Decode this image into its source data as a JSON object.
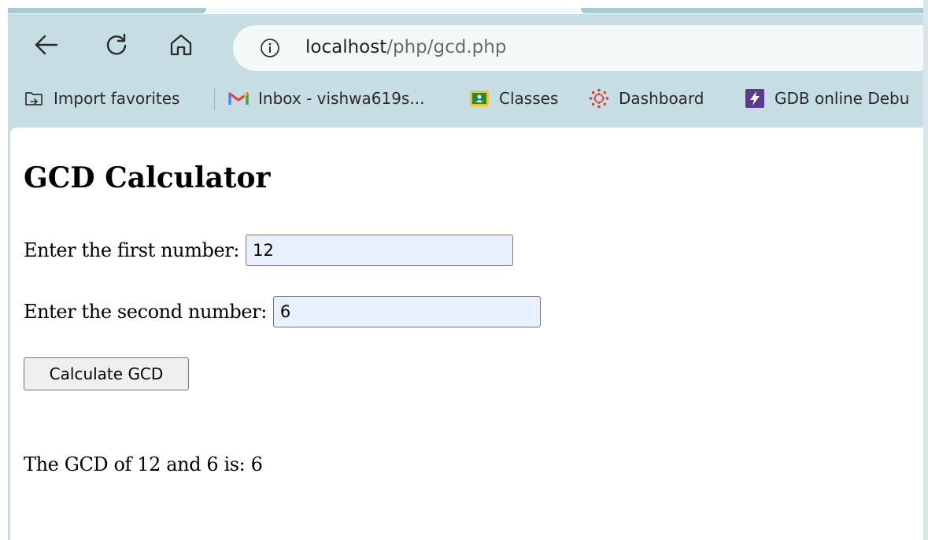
{
  "browser": {
    "url_host": "localhost",
    "url_path": "/php/gcd.php",
    "bookmarks": [
      {
        "label": "Import favorites",
        "icon": "import-favorites-icon"
      },
      {
        "label": "Inbox  - vishwa619s...",
        "icon": "gmail-icon"
      },
      {
        "label": "Classes",
        "icon": "google-classroom-icon"
      },
      {
        "label": "Dashboard",
        "icon": "canvas-lms-icon"
      },
      {
        "label": "GDB online Debu",
        "icon": "gdb-lightning-icon"
      }
    ]
  },
  "page": {
    "title": "GCD Calculator",
    "first_label": "Enter the first number:",
    "first_value": "12",
    "second_label": "Enter the second number:",
    "second_value": "6",
    "button_label": "Calculate GCD",
    "result": "The GCD of 12 and 6 is: 6"
  },
  "colors": {
    "frame": "#c6dde3",
    "input_autofill": "#e8f0fe",
    "gmail_red": "#ea4335",
    "classroom_yellow": "#f9c124",
    "canvas_red": "#e4392c",
    "gdb_purple": "#5b3a8e"
  }
}
